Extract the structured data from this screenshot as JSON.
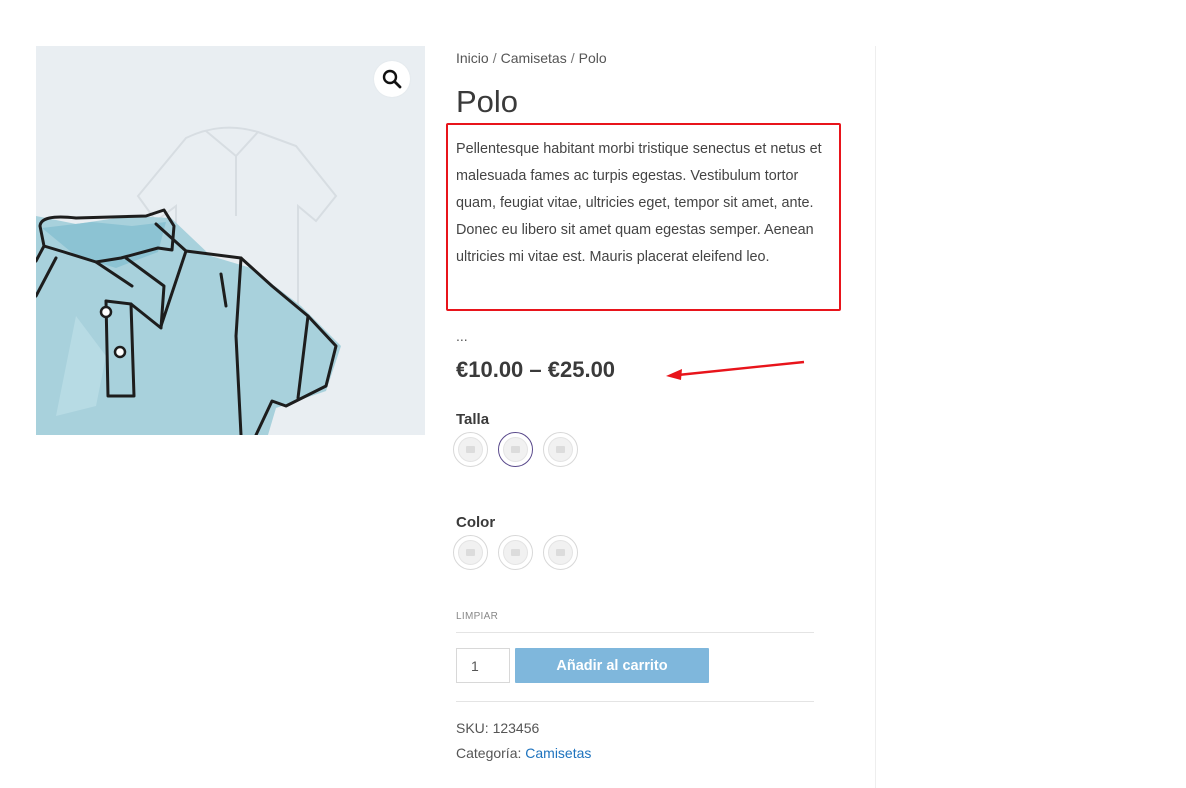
{
  "breadcrumb": {
    "home": "Inicio",
    "category": "Camisetas",
    "current": "Polo",
    "separator": "/"
  },
  "product": {
    "title": "Polo",
    "description": "Pellentesque habitant morbi tristique senectus et netus et malesuada fames ac turpis egestas. Vestibulum tortor quam, feugiat vitae, ultricies eget, tempor sit amet, ante. Donec eu libero sit amet quam egestas semper. Aenean ultricies mi vitae est. Mauris placerat eleifend leo.",
    "ellipsis": "...",
    "price": "€10.00 – €25.00"
  },
  "attributes": {
    "size": {
      "label": "Talla",
      "selected_index": 1,
      "option_count": 3
    },
    "color": {
      "label": "Color",
      "option_count": 3
    }
  },
  "form": {
    "reset_label": "LIMPIAR",
    "quantity": "1",
    "add_to_cart_label": "Añadir al carrito"
  },
  "meta": {
    "sku_label": "SKU:",
    "sku_value": "123456",
    "category_label": "Categoría:",
    "category_value": "Camisetas"
  },
  "icons": {
    "zoom": "search-icon"
  },
  "colors": {
    "highlight": "#e8141b",
    "button": "#7fb7dc",
    "link": "#1e73be",
    "selected_swatch": "#5a4a8c"
  }
}
